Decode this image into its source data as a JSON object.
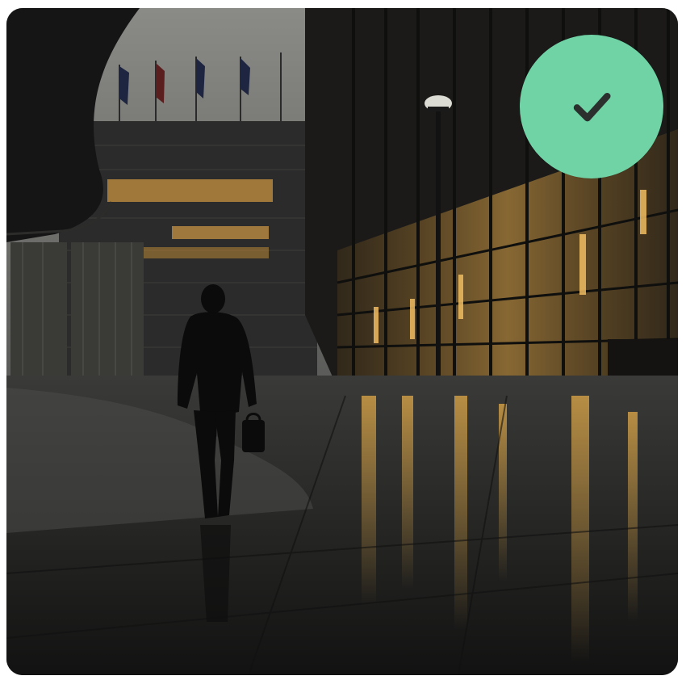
{
  "image_card": {
    "photo_subject": "",
    "selected": true
  },
  "selection_badge": {
    "icon": "checkmark-icon",
    "background_color": "#6fd3a6",
    "icon_color": "#2b2f2d"
  },
  "colors": {
    "sky": "#7a7a76",
    "building_dark": "#1c1c1c",
    "warm_light": "#d9a24a",
    "ground": "#222222",
    "page_background": "#ffffff"
  }
}
